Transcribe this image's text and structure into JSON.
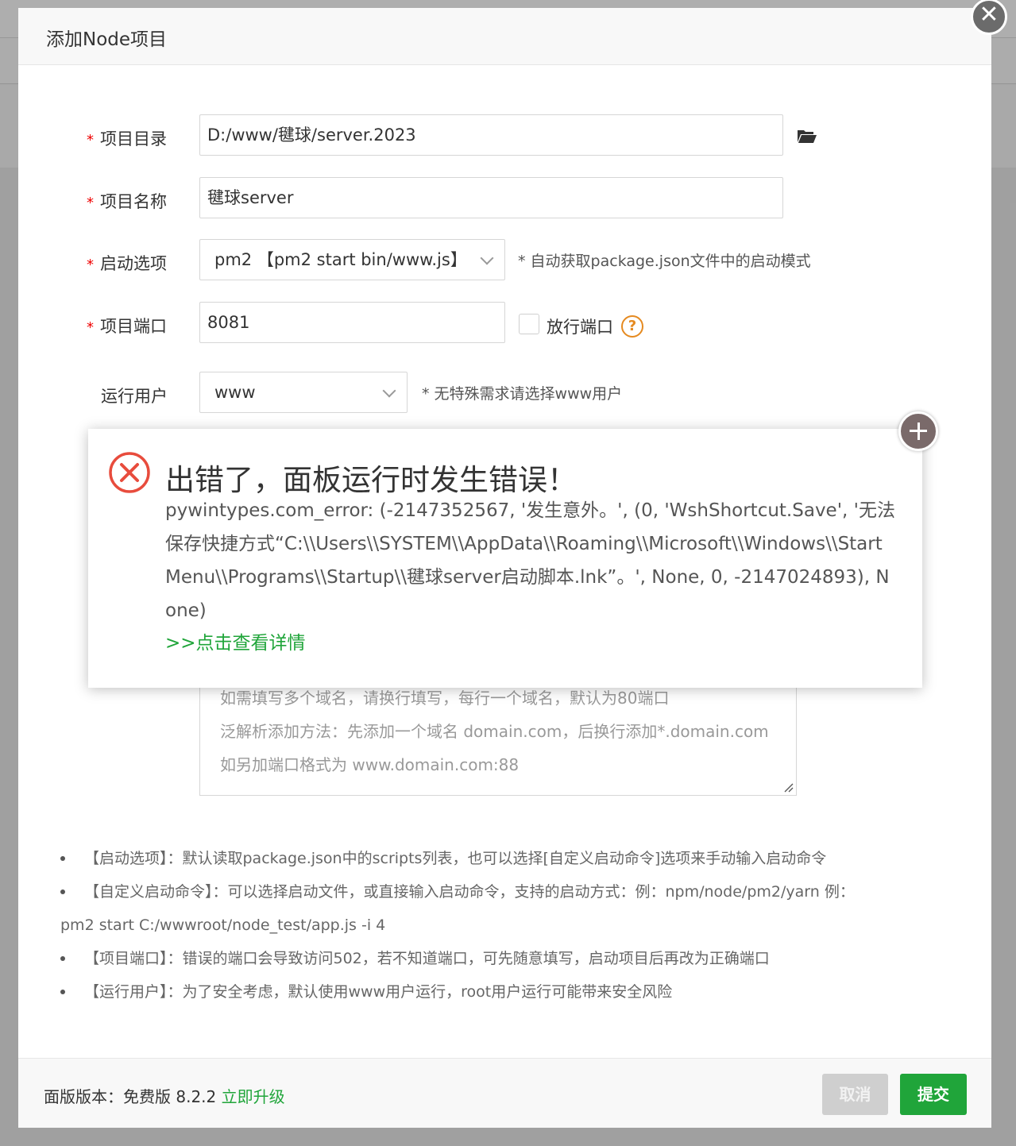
{
  "dialog": {
    "title": "添加Node项目",
    "close_symbol": "✕"
  },
  "form": {
    "directory": {
      "required": "*",
      "label": "项目目录",
      "value": "D:/www/毽球/server.2023",
      "icon": "folder-open-icon"
    },
    "name": {
      "required": "*",
      "label": "项目名称",
      "value": "毽球server"
    },
    "start_option": {
      "required": "*",
      "label": "启动选项",
      "value": "pm2 【pm2 start bin/www.js】",
      "hint": "* 自动获取package.json文件中的启动模式"
    },
    "port": {
      "required": "*",
      "label": "项目端口",
      "value": "8081",
      "checkbox_label": "放行端口",
      "checked": false,
      "help_symbol": "?"
    },
    "run_user": {
      "label": "运行用户",
      "value": "www",
      "hint": "* 无特殊需求请选择www用户"
    },
    "domain_placeholder": [
      "如需填写多个域名，请换行填写，每行一个域名，默认为80端口",
      "泛解析添加方法：先添加一个域名 domain.com，后换行添加*.domain.com",
      "如另加端口格式为 www.domain.com:88"
    ]
  },
  "notes": [
    "【启动选项】：默认读取package.json中的scripts列表，也可以选择[自定义启动命令]选项来手动输入启动命令",
    "【自定义启动命令】：可以选择启动文件，或直接输入启动命令，支持的启动方式：例：npm/node/pm2/yarn 例：",
    "pm2 start C:/wwwroot/node_test/app.js -i 4",
    "【项目端口】：错误的端口会导致访问502，若不知道端口，可先随意填写，启动项目后再改为正确端口",
    "【运行用户】：为了安全考虑，默认使用www用户运行，root用户运行可能带来安全风险"
  ],
  "footer": {
    "version_label": "面版版本：免费版 8.2.2",
    "upgrade_link": "立即升级",
    "cancel_label": "取消",
    "submit_label": "提交"
  },
  "error": {
    "title": "出错了，面板运行时发生错误！",
    "message": "pywintypes.com_error: (-2147352567, '发生意外。', (0, 'WshShortcut.Save', '无法保存快捷方式“C:\\\\Users\\\\SYSTEM\\\\AppData\\\\Roaming\\\\Microsoft\\\\Windows\\\\Start Menu\\\\Programs\\\\Startup\\\\毽球server启动脚本.lnk”。', None, 0, -2147024893), None)",
    "detail_link": ">>点击查看详情"
  },
  "colors": {
    "accent_green": "#20a53a",
    "required_red": "#ef0000",
    "error_red": "#e84c3d",
    "help_orange": "#e58a20"
  }
}
